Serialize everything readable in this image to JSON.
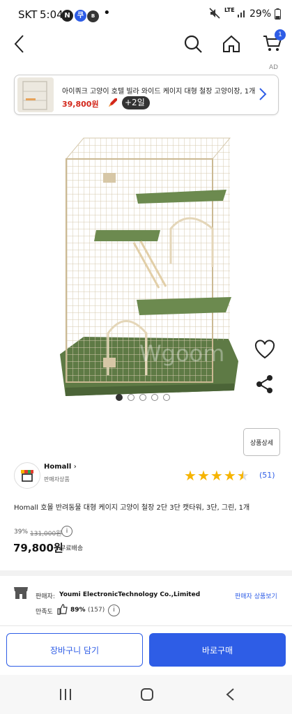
{
  "status_bar": {
    "carrier": "SKT",
    "time": "5:04",
    "battery": "29%",
    "network": "LTE"
  },
  "ad": {
    "label": "AD",
    "title": "아이쿼크 고양이 호텔 빌라 와이드 케이지 대형 철장 고양이장, 1개",
    "price": "39,800원",
    "badge": "+2일"
  },
  "gallery": {
    "watermark": "Wgoom",
    "dots": 5,
    "active": 0
  },
  "detail_button": "상품상세",
  "seller": {
    "name": "Homall",
    "type": "판매자상품"
  },
  "rating": {
    "stars": 4.5,
    "count": "(51)"
  },
  "product": {
    "title": "Homall 호몰 반려동물 대형 케이지 고양이 철장 2단 3단 캣타워, 3단, 그린, 1개",
    "discount": "39%",
    "original_price": "131,000원",
    "price": "79,800원",
    "shipping": "무료배송"
  },
  "seller_info": {
    "seller_label": "판매자:",
    "seller_name": "Youmi ElectronicTechnology Co.,Limited",
    "seller_link": "판매자 상품보기",
    "satisfaction_label": "만족도",
    "satisfaction_value": "89%",
    "satisfaction_count": "(157)"
  },
  "actions": {
    "cart": "장바구니 담기",
    "buy": "바로구매"
  },
  "colors": {
    "accent": "#2e5de6",
    "star": "#f6b400",
    "price_red": "#d3271b"
  }
}
